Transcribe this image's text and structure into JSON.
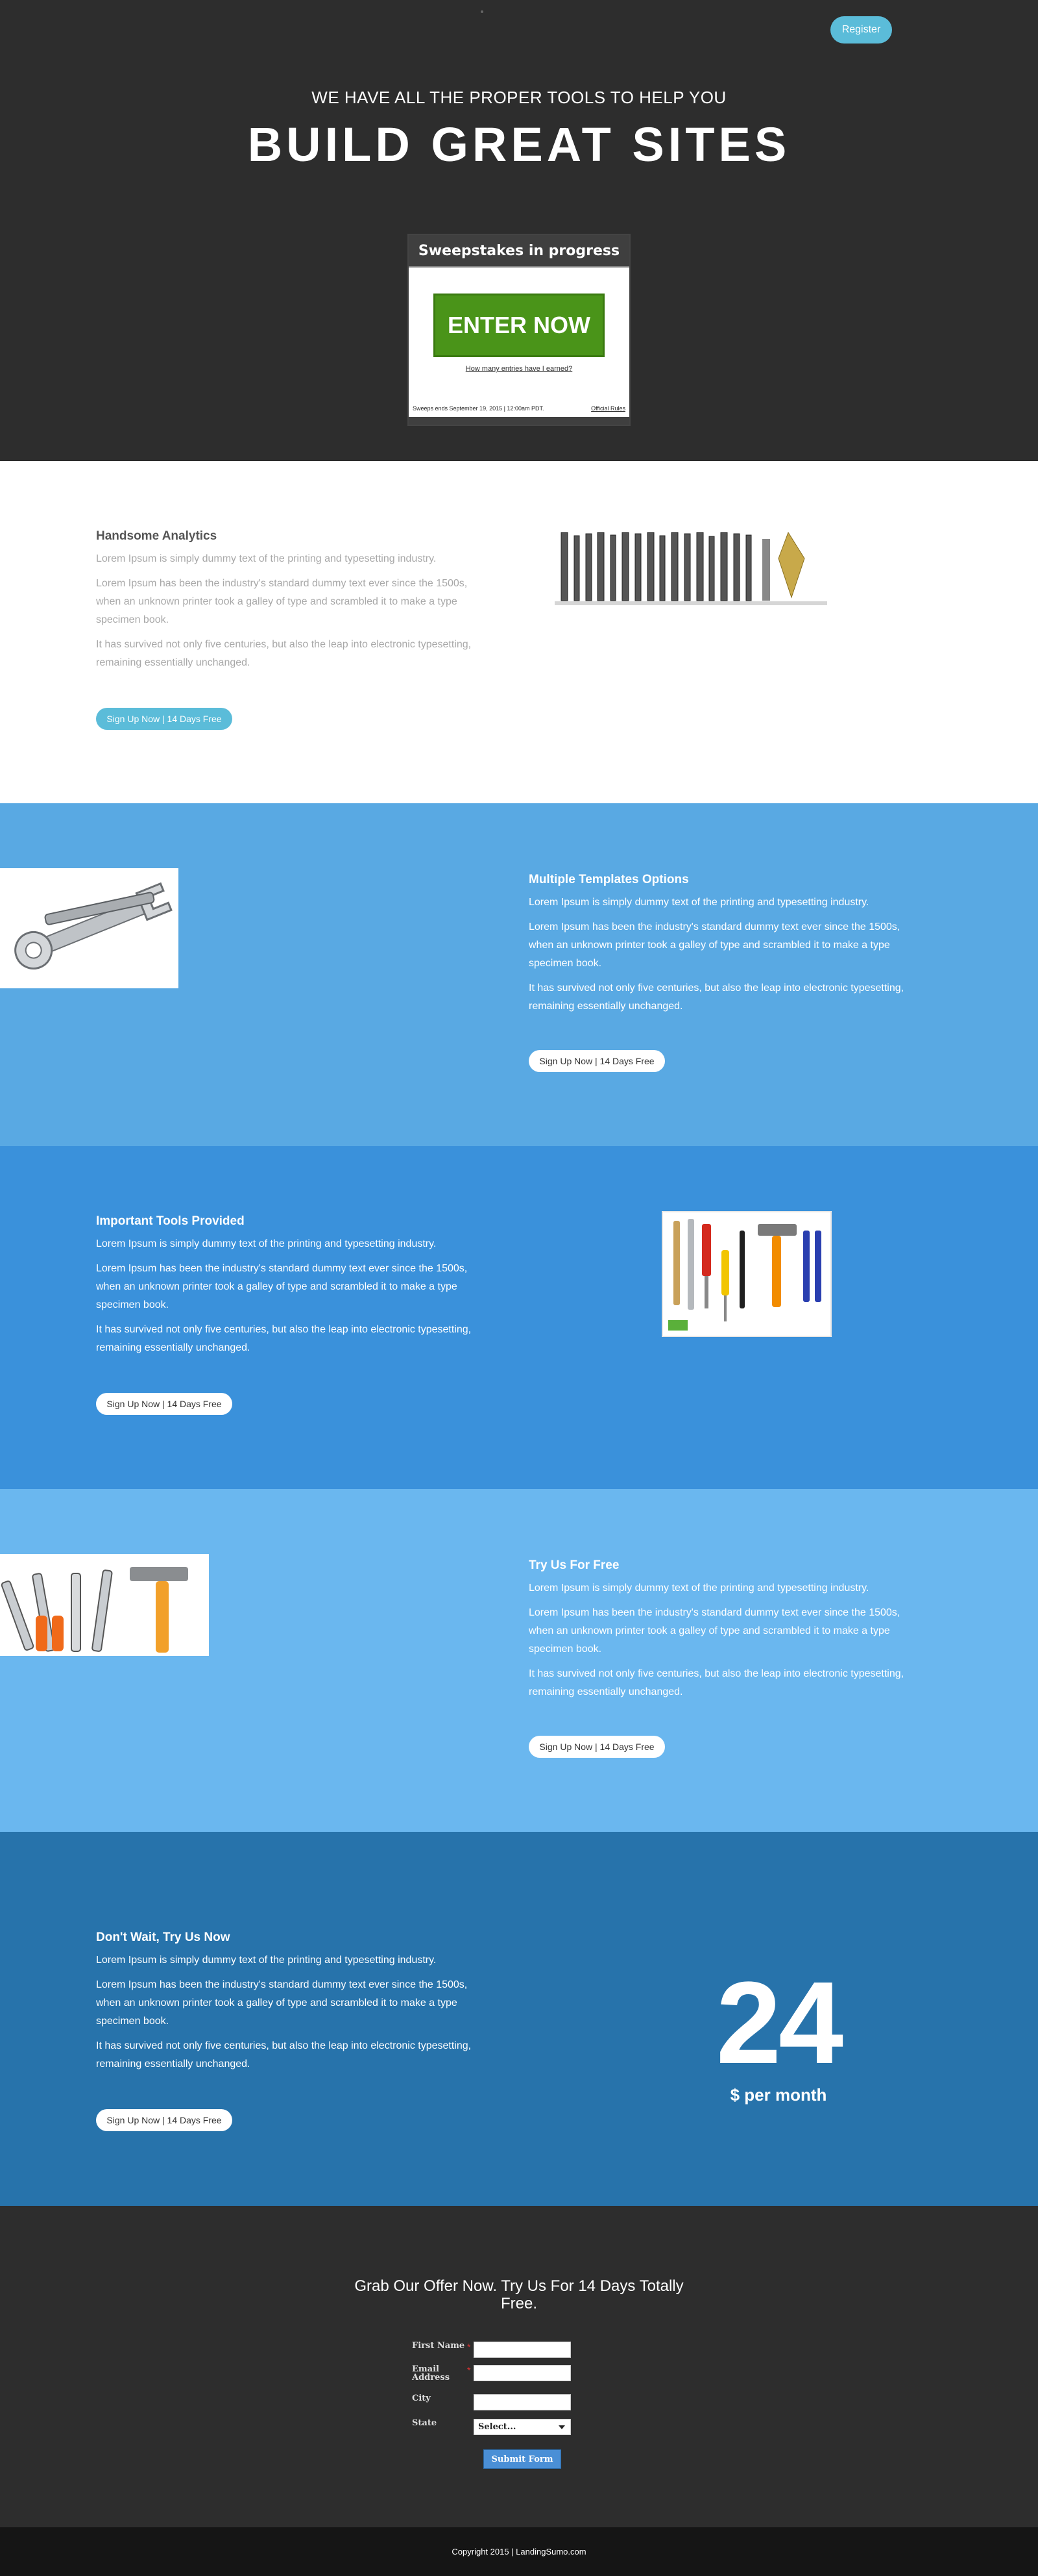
{
  "header": {
    "register_label": "Register"
  },
  "hero": {
    "subtitle": "WE HAVE ALL THE PROPER TOOLS TO HELP YOU",
    "title": "BUILD GREAT SITES"
  },
  "widget": {
    "heading": "Sweepstakes in progress",
    "enter_label": "ENTER NOW",
    "entries_link": "How many entries have I earned?",
    "ends_text": "Sweeps ends September 19, 2015 | 12:00am PDT.",
    "rules_link": "Official Rules"
  },
  "features": [
    {
      "title": "Handsome Analytics",
      "p1": "Lorem Ipsum is simply dummy text of the printing and typesetting industry.",
      "p2": "Lorem Ipsum has been the industry's standard dummy text ever since the 1500s, when an unknown printer took a galley of type and scrambled it to make a type specimen book.",
      "p3": "It has survived not only five centuries, but also the leap into electronic typesetting, remaining essentially unchanged.",
      "button": "Sign Up Now | 14 Days Free"
    },
    {
      "title": "Multiple Templates Options",
      "p1": "Lorem Ipsum is simply dummy text of the printing and typesetting industry.",
      "p2": "Lorem Ipsum has been the industry's standard dummy text ever since the 1500s, when an unknown printer took a galley of type and scrambled it to make a type specimen book.",
      "p3": "It has survived not only five centuries, but also the leap into electronic typesetting, remaining essentially unchanged.",
      "button": "Sign Up Now | 14 Days Free"
    },
    {
      "title": "Important Tools Provided",
      "p1": "Lorem Ipsum is simply dummy text of the printing and typesetting industry.",
      "p2": "Lorem Ipsum has been the industry's standard dummy text ever since the 1500s, when an unknown printer took a galley of type and scrambled it to make a type specimen book.",
      "p3": "It has survived not only five centuries, but also the leap into electronic typesetting, remaining essentially unchanged.",
      "button": "Sign Up Now | 14 Days Free"
    },
    {
      "title": "Try Us For Free",
      "p1": "Lorem Ipsum is simply dummy text of the printing and typesetting industry.",
      "p2": "Lorem Ipsum has been the industry's standard dummy text ever since the 1500s, when an unknown printer took a galley of type and scrambled it to make a type specimen book.",
      "p3": "It has survived not only five centuries, but also the leap into electronic typesetting, remaining essentially unchanged.",
      "button": "Sign Up Now | 14 Days Free"
    },
    {
      "title": "Don't Wait, Try Us Now",
      "p1": "Lorem Ipsum is simply dummy text of the printing and typesetting industry.",
      "p2": "Lorem Ipsum has been the industry's standard dummy text ever since the 1500s, when an unknown printer took a galley of type and scrambled it to make a type specimen book.",
      "p3": "It has survived not only five centuries, but also the leap into electronic typesetting, remaining essentially unchanged.",
      "button": "Sign Up Now | 14 Days Free"
    }
  ],
  "pricing": {
    "amount": "24",
    "label": "$ per month"
  },
  "form": {
    "title": "Grab Our Offer Now. Try Us For 14 Days Totally Free.",
    "first_name_label": "First Name",
    "email_label": "Email Address",
    "city_label": "City",
    "state_label": "State",
    "required_mark": "*",
    "state_value": "Select...",
    "submit_label": "Submit Form"
  },
  "footer": {
    "copyright": "Copyright 2015 | LandingSumo.com"
  },
  "colors": {
    "accent": "#5bbcd9",
    "dark": "#2d2d2d",
    "enter_green": "#4a9419",
    "section2": "#59a9e3",
    "section3": "#3a91db",
    "section4": "#6ab7ef",
    "section5": "#2773ab"
  }
}
